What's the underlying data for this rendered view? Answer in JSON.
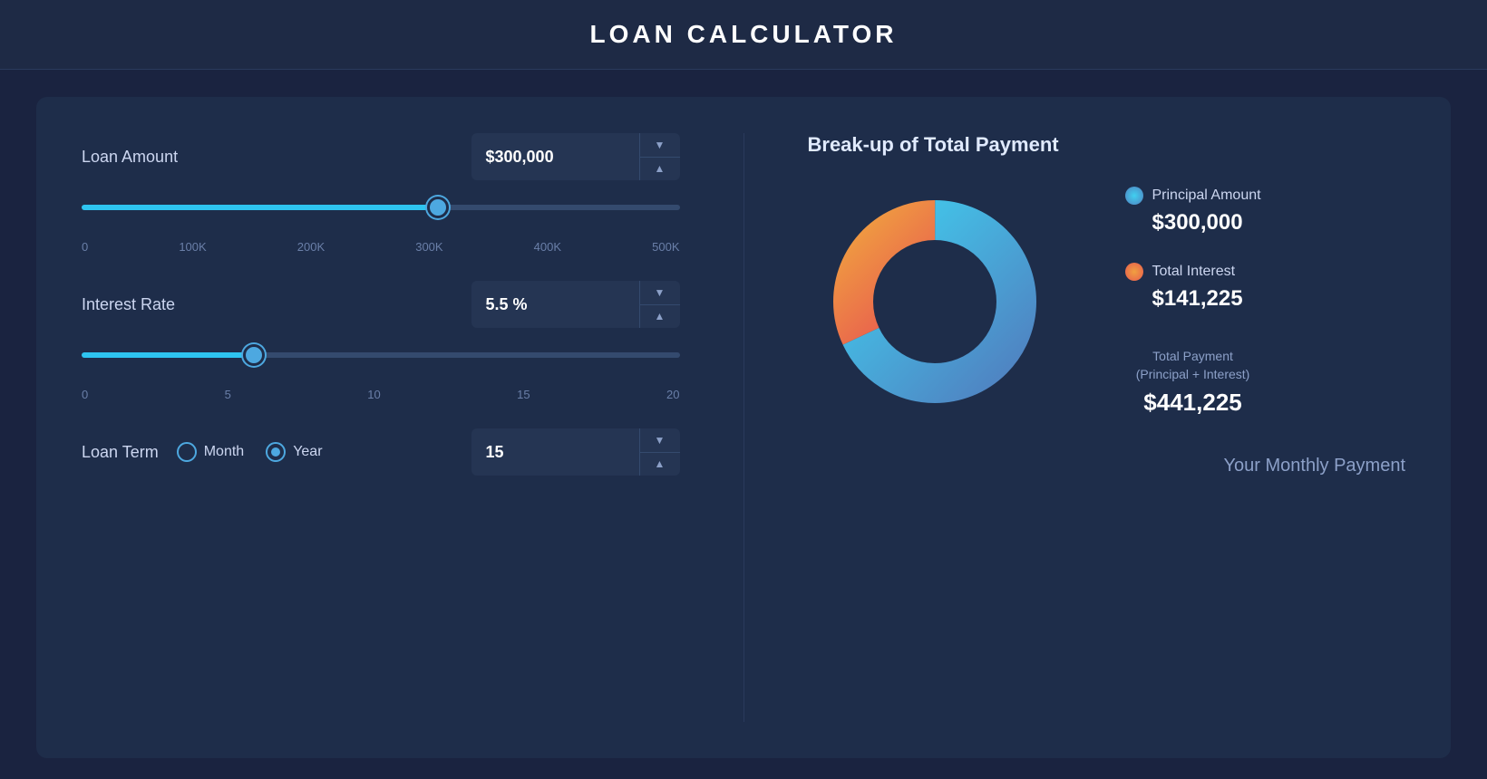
{
  "header": {
    "title": "LOAN CALCULATOR"
  },
  "left": {
    "loan_amount_label": "Loan Amount",
    "loan_amount_value": "$300,000",
    "loan_slider_min": "0",
    "loan_slider_ticks": [
      "0",
      "100K",
      "200K",
      "300K",
      "400K",
      "500K"
    ],
    "loan_slider_value": 60,
    "interest_rate_label": "Interest Rate",
    "interest_rate_value": "5.5 %",
    "rate_slider_ticks": [
      "0",
      "5",
      "10",
      "15",
      "20"
    ],
    "rate_slider_value": 27.5,
    "loan_term_label": "Loan Term",
    "month_label": "Month",
    "year_label": "Year",
    "loan_term_value": "15",
    "spinner_down": "▼",
    "spinner_up": "▲"
  },
  "right": {
    "breakup_title": "Break-up of Total Payment",
    "principal_label": "Principal Amount",
    "principal_value": "$300,000",
    "interest_label": "Total Interest",
    "interest_value": "$141,225",
    "total_label": "Total Payment",
    "total_sublabel": "(Principal + Interest)",
    "total_value": "$441,225",
    "monthly_payment_title": "Your Monthly Payment",
    "principal_color": "#4dc8e8",
    "interest_color": "#e85a4f",
    "donut": {
      "principal_pct": 68,
      "interest_pct": 32
    }
  }
}
